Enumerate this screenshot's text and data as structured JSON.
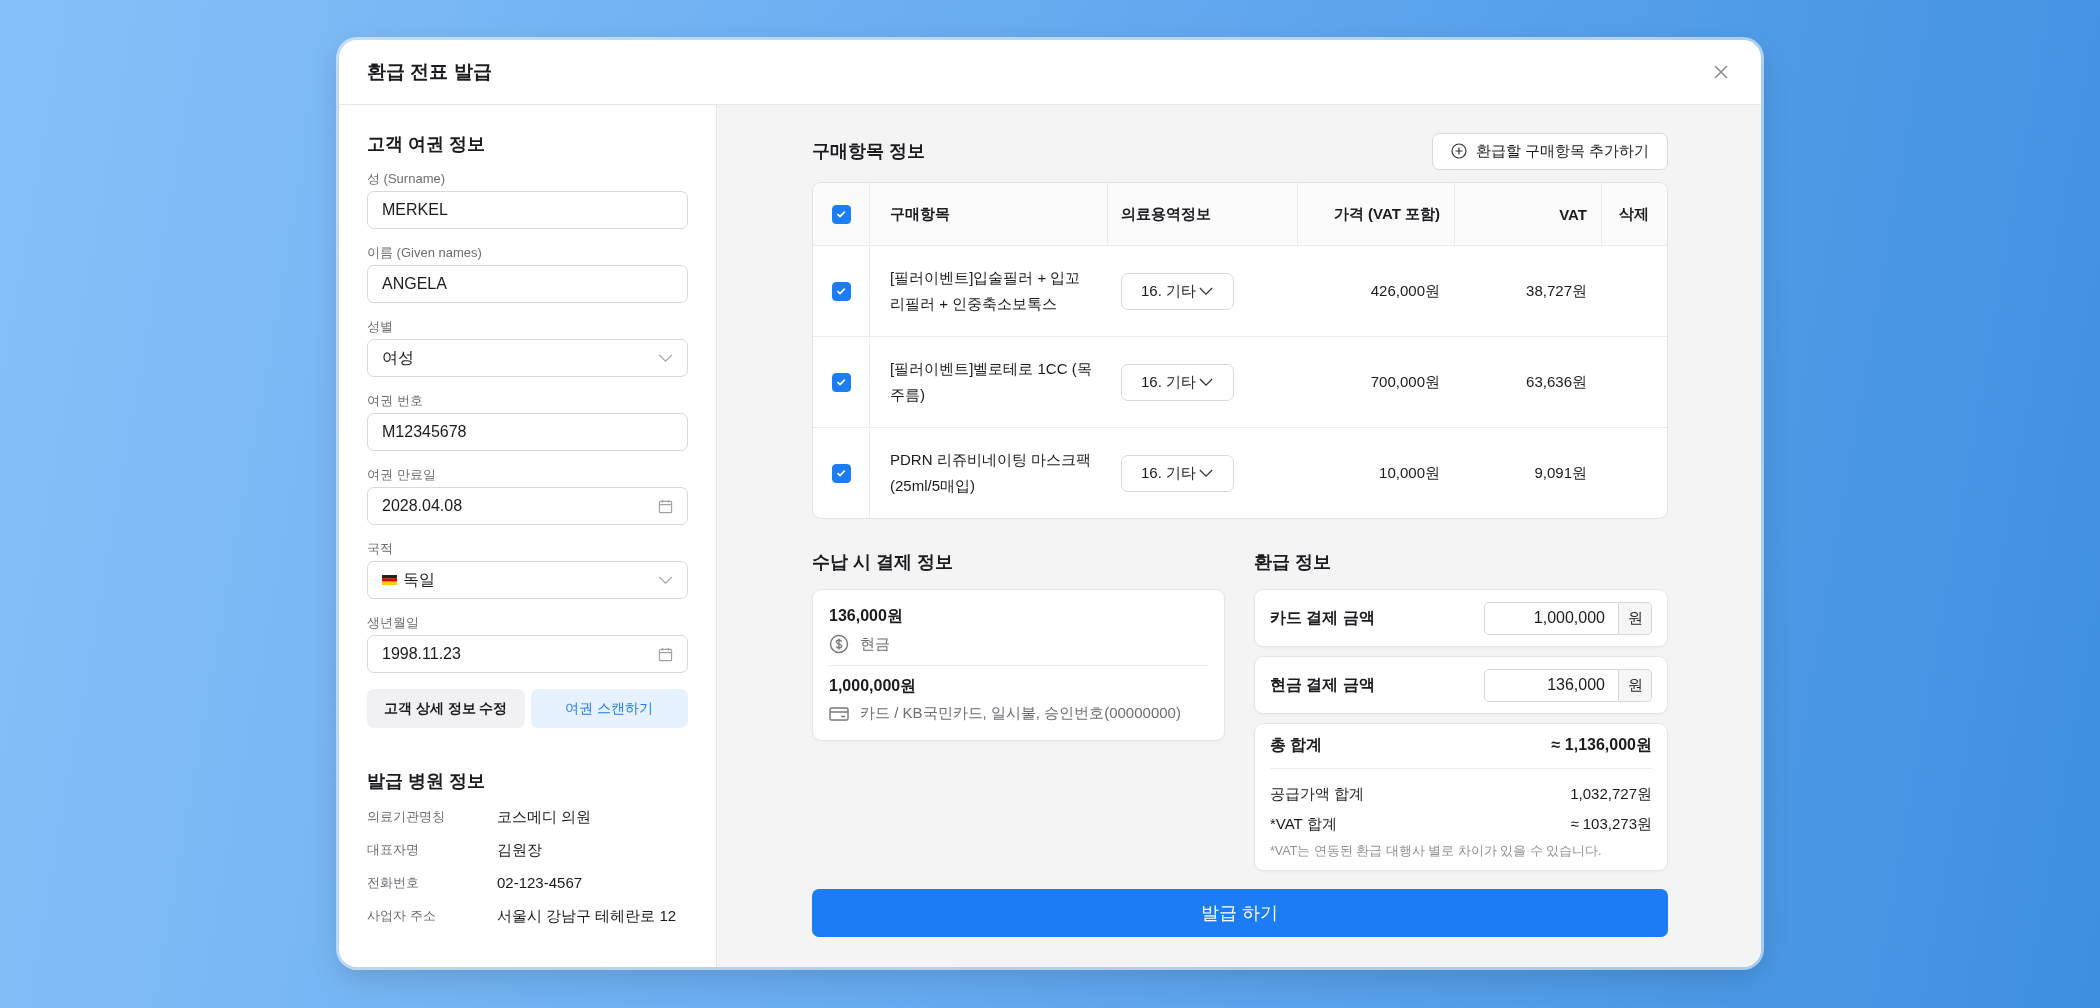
{
  "window": {
    "title": "환급 전표 발급"
  },
  "customer_passport": {
    "title": "고객 여권 정보",
    "fields": [
      {
        "kind": "text",
        "label": "성 (Surname)",
        "value": "MERKEL"
      },
      {
        "kind": "text",
        "label": "이름 (Given names)",
        "value": "ANGELA"
      },
      {
        "kind": "select",
        "label": "성별",
        "value": "여성"
      },
      {
        "kind": "text",
        "label": "여권 번호",
        "value": "M12345678"
      },
      {
        "kind": "date",
        "label": "여권 만료일",
        "value": "2028.04.08"
      },
      {
        "kind": "flag_select",
        "label": "국적",
        "value": "독일"
      },
      {
        "kind": "date",
        "label": "생년월일",
        "value": "1998.11.23"
      }
    ],
    "buttons": [
      {
        "kind": "secondary",
        "label": "고객 상세 정보 수정"
      },
      {
        "kind": "primary_light",
        "label": "여권 스캔하기"
      }
    ]
  },
  "hospital": {
    "title": "발급 병원 정보",
    "rows": [
      {
        "label": "의료기관명칭",
        "value": "코스메디 의원"
      },
      {
        "label": "대표자명",
        "value": "김원장"
      },
      {
        "label": "전화번호",
        "value": "02-123-4567"
      },
      {
        "label": "사업자 주소",
        "value": "서울시 강남구 테헤란로 12"
      }
    ]
  },
  "purchase_items": {
    "title": "구매항목 정보",
    "add_button": "환급할 구매항목 추가하기",
    "all_checked": true,
    "columns": [
      "구매항목",
      "의료용역정보",
      "가격 (VAT 포함)",
      "VAT",
      "삭제"
    ],
    "rows": [
      {
        "checked": true,
        "item": "[필러이벤트]입술필러 + 입꼬리필러 + 인중축소보톡스",
        "service": "16. 기타",
        "price": "426,000원",
        "vat": "38,727원"
      },
      {
        "checked": true,
        "item": "[필러이벤트]벨로테로 1CC (목주름)",
        "service": "16. 기타",
        "price": "700,000원",
        "vat": "63,636원"
      },
      {
        "checked": true,
        "item": "PDRN 리쥬비네이팅 마스크팩 (25ml/5매입)",
        "service": "16. 기타",
        "price": "10,000원",
        "vat": "9,091원"
      }
    ]
  },
  "payment_info": {
    "title": "수납 시 결제 정보",
    "entries": [
      {
        "kind": "cash",
        "amount": "136,000원",
        "detail": "현금"
      },
      {
        "kind": "card",
        "amount": "1,000,000원",
        "detail": "카드 / KB국민카드, 일시불, 승인번호(00000000)"
      }
    ]
  },
  "refund_info": {
    "title": "환급 정보",
    "inputs": [
      {
        "label": "카드 결제 금액",
        "value": "1,000,000",
        "unit": "원"
      },
      {
        "label": "현금 결제 금액",
        "value": "136,000",
        "unit": "원"
      }
    ],
    "total": {
      "label": "총 합계",
      "value": "≈ 1,136,000원"
    },
    "lines": [
      {
        "label": "공급가액 합계",
        "value": "1,032,727원"
      },
      {
        "label": "*VAT 합계",
        "value": "≈ 103,273원"
      }
    ],
    "note": "*VAT는 연동된 환급 대행사 별로 차이가 있을 수 있습니다."
  },
  "submit_button": "발급 하기"
}
